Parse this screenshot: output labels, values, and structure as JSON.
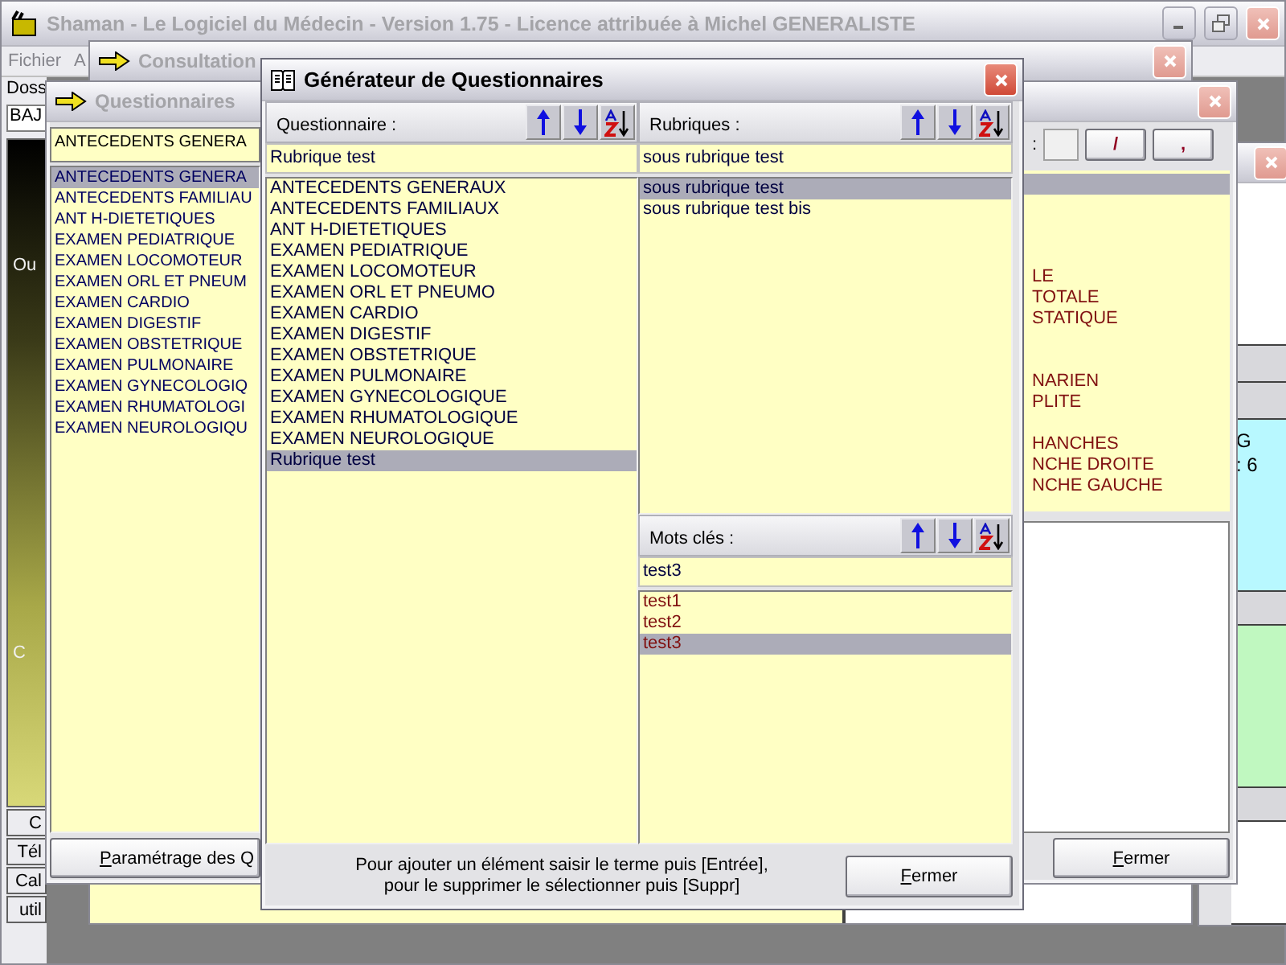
{
  "main_window": {
    "title": "Shaman - Le Logiciel du Médecin - Version 1.75 - Licence attribuée à Michel GENERALISTE",
    "menu": [
      "Fichier",
      "A"
    ]
  },
  "left_panel": {
    "field_label": "Doss",
    "field_value": "BAJ",
    "sidebar_labels": [
      "Ou",
      "C"
    ],
    "buttons": [
      "C",
      "Tél",
      "Cal",
      "util"
    ]
  },
  "consultation_window": {
    "title": "Consultation"
  },
  "side_window": {
    "texts": [
      "G",
      ": 6"
    ]
  },
  "questionnaires_window": {
    "title": "Questionnaires",
    "search_value": "ANTECEDENTS GENERA",
    "items": [
      {
        "label": "ANTECEDENTS GENERA",
        "selected": true
      },
      {
        "label": "ANTECEDENTS FAMILIAU",
        "selected": false
      },
      {
        "label": "ANT H-DIETETIQUES",
        "selected": false
      },
      {
        "label": "EXAMEN PEDIATRIQUE",
        "selected": false
      },
      {
        "label": "EXAMEN LOCOMOTEUR",
        "selected": false
      },
      {
        "label": "EXAMEN ORL ET PNEUM",
        "selected": false
      },
      {
        "label": "EXAMEN CARDIO",
        "selected": false
      },
      {
        "label": "EXAMEN DIGESTIF",
        "selected": false
      },
      {
        "label": "EXAMEN OBSTETRIQUE",
        "selected": false
      },
      {
        "label": "EXAMEN PULMONAIRE",
        "selected": false
      },
      {
        "label": "EXAMEN GYNECOLOGIQ",
        "selected": false
      },
      {
        "label": "EXAMEN RHUMATOLOGI",
        "selected": false
      },
      {
        "label": "EXAMEN NEUROLOGIQU",
        "selected": false
      }
    ],
    "settings_button": "Paramétrage des Q",
    "field_label": ":",
    "format_buttons": [
      "/",
      ","
    ],
    "right_groups": [
      [
        "LE",
        "TOTALE",
        "STATIQUE"
      ],
      [
        "NARIEN",
        "PLITE"
      ],
      [
        "HANCHES",
        "NCHE DROITE",
        "NCHE GAUCHE"
      ]
    ],
    "close_button": "Fermer"
  },
  "generator": {
    "title": "Générateur de Questionnaires",
    "questionnaire": {
      "label": "Questionnaire :",
      "value": "Rubrique test",
      "items": [
        {
          "label": "ANTECEDENTS GENERAUX",
          "selected": false
        },
        {
          "label": "ANTECEDENTS FAMILIAUX",
          "selected": false
        },
        {
          "label": "ANT H-DIETETIQUES",
          "selected": false
        },
        {
          "label": "EXAMEN PEDIATRIQUE",
          "selected": false
        },
        {
          "label": "EXAMEN LOCOMOTEUR",
          "selected": false
        },
        {
          "label": "EXAMEN ORL ET PNEUMO",
          "selected": false
        },
        {
          "label": "EXAMEN CARDIO",
          "selected": false
        },
        {
          "label": "EXAMEN DIGESTIF",
          "selected": false
        },
        {
          "label": "EXAMEN OBSTETRIQUE",
          "selected": false
        },
        {
          "label": "EXAMEN PULMONAIRE",
          "selected": false
        },
        {
          "label": "EXAMEN GYNECOLOGIQUE",
          "selected": false
        },
        {
          "label": "EXAMEN RHUMATOLOGIQUE",
          "selected": false
        },
        {
          "label": "EXAMEN NEUROLOGIQUE",
          "selected": false
        },
        {
          "label": "Rubrique test",
          "selected": true
        }
      ]
    },
    "rubriques": {
      "label": "Rubriques :",
      "value": "sous rubrique test",
      "items": [
        {
          "label": "sous rubrique test",
          "selected": true
        },
        {
          "label": "sous rubrique test bis",
          "selected": false
        }
      ]
    },
    "mots_cles": {
      "label": "Mots clés :",
      "value": "test3",
      "items": [
        {
          "label": "test1",
          "selected": false
        },
        {
          "label": "test2",
          "selected": false
        },
        {
          "label": "test3",
          "selected": true
        }
      ]
    },
    "hint": [
      "Pour ajouter un élément saisir le terme puis [Entrée],",
      "pour le supprimer le sélectionner puis [Suppr]"
    ],
    "close_button": "Fermer"
  }
}
